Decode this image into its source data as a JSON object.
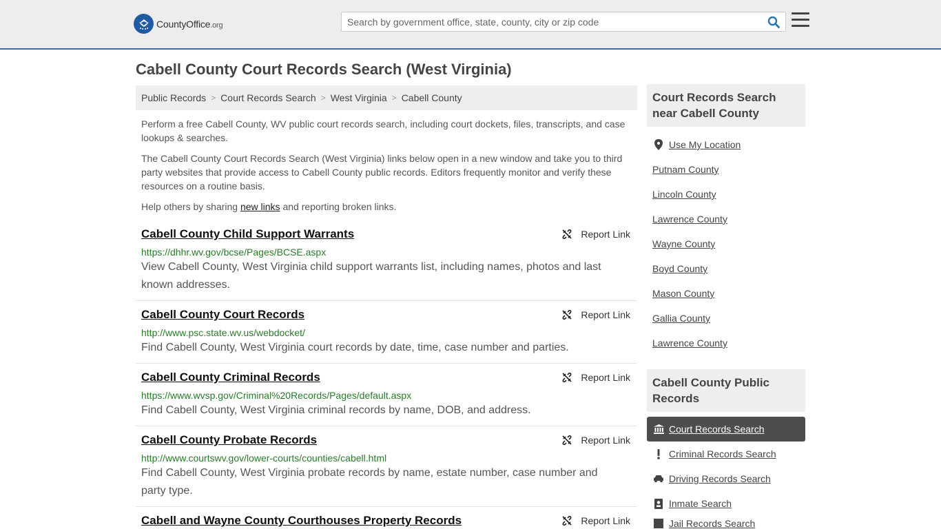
{
  "header": {
    "logo_main": "CountyOffice",
    "logo_ext": ".org",
    "search_placeholder": "Search by government office, state, county, city or zip code"
  },
  "page_title": "Cabell County Court Records Search (West Virginia)",
  "breadcrumb": [
    "Public Records",
    "Court Records Search",
    "West Virginia",
    "Cabell County"
  ],
  "intro": {
    "p1": "Perform a free Cabell County, WV public court records search, including court dockets, files, transcripts, and case lookups & searches.",
    "p2": "The Cabell County Court Records Search (West Virginia) links below open in a new window and take you to third party websites that provide access to Cabell County public records. Editors frequently monitor and verify these resources on a routine basis.",
    "p3_before": "Help others by sharing ",
    "p3_link": "new links",
    "p3_after": " and reporting broken links."
  },
  "report_label": "Report Link",
  "results": [
    {
      "title": "Cabell County Child Support Warrants",
      "url": "https://dhhr.wv.gov/bcse/Pages/BCSE.aspx",
      "desc": "View Cabell County, West Virginia child support warrants list, including names, photos and last known addresses."
    },
    {
      "title": "Cabell County Court Records",
      "url": "http://www.psc.state.wv.us/webdocket/",
      "desc": "Find Cabell County, West Virginia court records by date, time, case number and parties."
    },
    {
      "title": "Cabell County Criminal Records",
      "url": "https://www.wvsp.gov/Criminal%20Records/Pages/default.aspx",
      "desc": "Find Cabell County, West Virginia criminal records by name, DOB, and address."
    },
    {
      "title": "Cabell County Probate Records",
      "url": "http://www.courtswv.gov/lower-courts/counties/cabell.html",
      "desc": "Find Cabell County, West Virginia probate records by name, estate number, case number and party type."
    },
    {
      "title": "Cabell and Wayne County Courthouses Property Records",
      "url": "",
      "desc": ""
    }
  ],
  "sidebar": {
    "near_heading": "Court Records Search near Cabell County",
    "use_location": "Use My Location",
    "near_items": [
      "Putnam County",
      "Lincoln County",
      "Lawrence County",
      "Wayne County",
      "Boyd County",
      "Mason County",
      "Gallia County",
      "Lawrence County"
    ],
    "public_heading": "Cabell County Public Records",
    "public_items": [
      {
        "label": "Court Records Search",
        "icon": "courthouse-icon",
        "active": true
      },
      {
        "label": "Criminal Records Search",
        "icon": "exclamation-icon",
        "active": false
      },
      {
        "label": "Driving Records Search",
        "icon": "car-icon",
        "active": false
      },
      {
        "label": "Inmate Search",
        "icon": "id-badge-icon",
        "active": false
      },
      {
        "label": "Jail Records Search",
        "icon": "jail-icon",
        "active": false
      }
    ]
  },
  "colors": {
    "accent": "#2c72b6",
    "url_green": "#2a7a2a",
    "active_bg": "#4d4d4d"
  }
}
